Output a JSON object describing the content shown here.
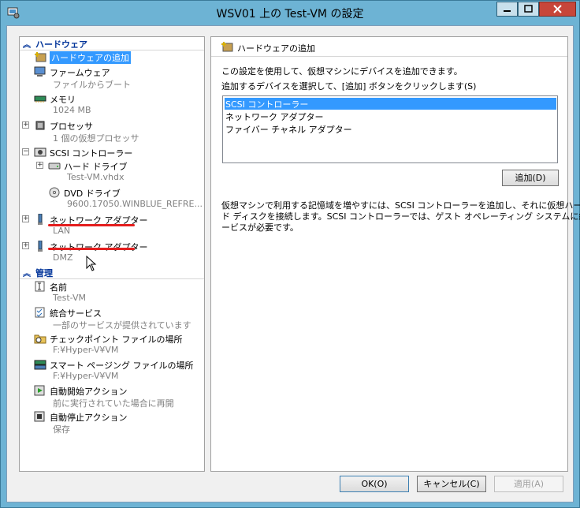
{
  "window": {
    "title": "WSV01 上の Test-VM の設定"
  },
  "tree": {
    "hardware_header": "ハードウェア",
    "management_header": "管理",
    "items": [
      {
        "name": "add-hardware",
        "label": "ハードウェアの追加",
        "sub": ""
      },
      {
        "name": "firmware",
        "label": "ファームウェア",
        "sub": "ファイルからブート"
      },
      {
        "name": "memory",
        "label": "メモリ",
        "sub": "1024 MB"
      },
      {
        "name": "processor",
        "label": "プロセッサ",
        "sub": "1 個の仮想プロセッサ"
      },
      {
        "name": "scsi-controller",
        "label": "SCSI コントローラー",
        "sub": ""
      },
      {
        "name": "hard-drive",
        "label": "ハード ドライブ",
        "sub": "Test-VM.vhdx"
      },
      {
        "name": "dvd-drive",
        "label": "DVD ドライブ",
        "sub": "9600.17050.WINBLUE_REFRE..."
      },
      {
        "name": "network-adapter-1",
        "label": "ネットワーク アダプター",
        "sub": "LAN"
      },
      {
        "name": "network-adapter-2",
        "label": "ネットワーク アダプター",
        "sub": "DMZ"
      }
    ],
    "management": [
      {
        "name": "vm-name",
        "label": "名前",
        "sub": "Test-VM"
      },
      {
        "name": "integration-services",
        "label": "統合サービス",
        "sub": "一部のサービスが提供されています"
      },
      {
        "name": "checkpoint-location",
        "label": "チェックポイント ファイルの場所",
        "sub": "F:¥Hyper-V¥VM"
      },
      {
        "name": "smart-paging-location",
        "label": "スマート ページング ファイルの場所",
        "sub": "F:¥Hyper-V¥VM"
      },
      {
        "name": "auto-start",
        "label": "自動開始アクション",
        "sub": "前に実行されていた場合に再開"
      },
      {
        "name": "auto-stop",
        "label": "自動停止アクション",
        "sub": "保存"
      }
    ]
  },
  "panel": {
    "header": "ハードウェアの追加",
    "intro": "この設定を使用して、仮想マシンにデバイスを追加できます。",
    "instruction": "追加するデバイスを選択して、[追加] ボタンをクリックします(S)",
    "devices": [
      "SCSI コントローラー",
      "ネットワーク アダプター",
      "ファイバー チャネル アダプター"
    ],
    "add_button": "追加(D)",
    "description_1": "仮想マシンで利用する記憶域を増やすには、SCSI コントローラーを追加し、それに仮想ハー",
    "description_2": "ド ディスクを接続します。SCSI コントローラーでは、ゲスト オペレーティング システムに統合サ",
    "description_3": "ービスが必要です。"
  },
  "buttons": {
    "ok": "OK(O)",
    "cancel": "キャンセル(C)",
    "apply": "適用(A)"
  },
  "colors": {
    "selection": "#3399ff",
    "annotation_underline": "#e41e1e",
    "titlebar": "#6db3d4",
    "close_button": "#c7463a"
  }
}
